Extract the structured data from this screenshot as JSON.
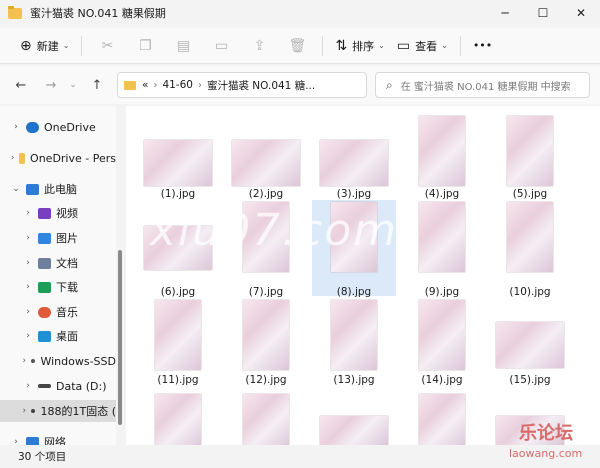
{
  "window": {
    "title": "蜜汁猫裘 NO.041 糖果假期",
    "controls": {
      "minimize": "─",
      "maximize": "☐",
      "close": "✕"
    }
  },
  "toolbar": {
    "new_label": "新建",
    "sort_label": "排序",
    "view_label": "查看",
    "more_label": "•••",
    "icons": [
      "cut-icon",
      "copy-icon",
      "paste-icon",
      "rename-icon",
      "share-icon",
      "delete-icon"
    ]
  },
  "address": {
    "overflow": "«",
    "crumbs": [
      "41-60",
      "蜜汁猫裘 NO.041 糖..."
    ],
    "search_placeholder": "在 蜜汁猫裘 NO.041 糖果假期 中搜索"
  },
  "sidebar": {
    "items": [
      {
        "label": "OneDrive",
        "chevron": "›",
        "icon": "cloud-icon",
        "color": "#1f73c9"
      },
      {
        "label": "OneDrive - Pers",
        "chevron": "›",
        "icon": "folder-icon",
        "color": "#f2c14e"
      },
      {
        "label": "此电脑",
        "chevron": "⌄",
        "icon": "computer-icon",
        "color": "#2c7bd6"
      },
      {
        "label": "视频",
        "chevron": "›",
        "icon": "video-icon",
        "color": "#7a3fbf"
      },
      {
        "label": "图片",
        "chevron": "›",
        "icon": "pictures-icon",
        "color": "#2e86de"
      },
      {
        "label": "文档",
        "chevron": "›",
        "icon": "documents-icon",
        "color": "#6d7f9c"
      },
      {
        "label": "下载",
        "chevron": "›",
        "icon": "download-icon",
        "color": "#1b9e5a"
      },
      {
        "label": "音乐",
        "chevron": "›",
        "icon": "music-icon",
        "color": "#e05a3a"
      },
      {
        "label": "桌面",
        "chevron": "›",
        "icon": "desktop-icon",
        "color": "#1e90d6"
      },
      {
        "label": "Windows-SSD",
        "chevron": "›",
        "icon": "drive-icon",
        "color": "#555555"
      },
      {
        "label": "Data (D:)",
        "chevron": "›",
        "icon": "drive-icon",
        "color": "#444444"
      },
      {
        "label": "188的1T固态 (",
        "chevron": "›",
        "icon": "drive-icon",
        "color": "#444444"
      },
      {
        "label": "网络",
        "chevron": "›",
        "icon": "network-icon",
        "color": "#2c7bd6"
      }
    ]
  },
  "files": [
    {
      "name": "(1).jpg"
    },
    {
      "name": "(2).jpg"
    },
    {
      "name": "(3).jpg"
    },
    {
      "name": "(4).jpg"
    },
    {
      "name": "(5).jpg"
    },
    {
      "name": "(6).jpg"
    },
    {
      "name": "(7).jpg"
    },
    {
      "name": "(8).jpg"
    },
    {
      "name": "(9).jpg"
    },
    {
      "name": "(10).jpg"
    },
    {
      "name": "(11).jpg"
    },
    {
      "name": "(12).jpg"
    },
    {
      "name": "(13).jpg"
    },
    {
      "name": "(14).jpg"
    },
    {
      "name": "(15).jpg"
    },
    {
      "name": ""
    },
    {
      "name": ""
    },
    {
      "name": ""
    },
    {
      "name": ""
    },
    {
      "name": ""
    }
  ],
  "status": {
    "count": "30 个项目"
  },
  "overlay": {
    "watermark": "xiu07.com",
    "stamp": "乐论坛",
    "stamp_url": "laowang.com"
  }
}
